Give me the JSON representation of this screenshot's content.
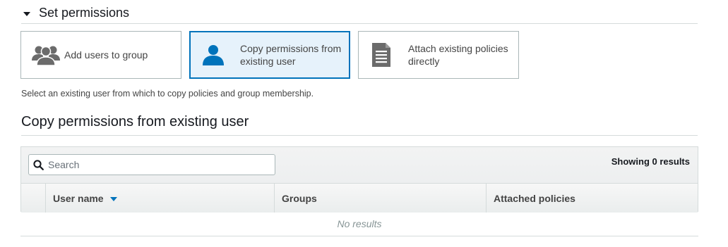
{
  "section": {
    "title": "Set permissions",
    "caret": "caret-down-icon"
  },
  "tiles": [
    {
      "label": "Add users to group",
      "icon": "user-group-icon",
      "selected": false
    },
    {
      "label": "Copy permissions from existing user",
      "icon": "user-icon",
      "selected": true
    },
    {
      "label": "Attach existing policies directly",
      "icon": "document-icon",
      "selected": false
    }
  ],
  "hint": "Select an existing user from which to copy policies and group membership.",
  "copy_section": {
    "title": "Copy permissions from existing user"
  },
  "table": {
    "search": {
      "placeholder": "Search",
      "value": "",
      "icon": "search-icon"
    },
    "showing_results": "Showing 0 results",
    "columns": [
      {
        "label": "User name",
        "sorted": "desc"
      },
      {
        "label": "Groups"
      },
      {
        "label": "Attached policies"
      }
    ],
    "empty_text": "No results"
  },
  "colors": {
    "accent": "#0073bb",
    "selected_bg": "#e6f2fb",
    "icon_gray": "#6b6b6b"
  }
}
